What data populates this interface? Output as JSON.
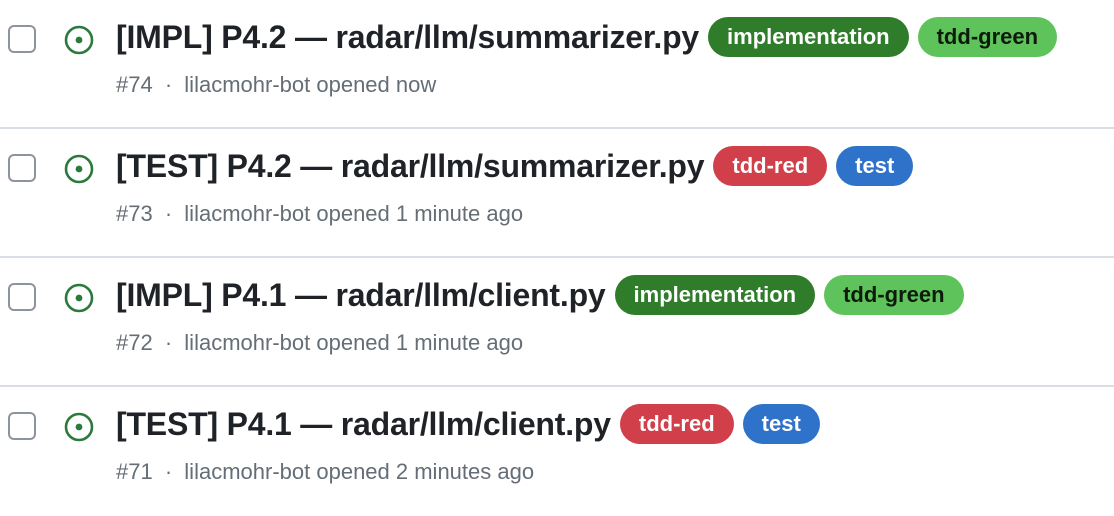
{
  "issues": [
    {
      "title": "[IMPL] P4.2 — radar/llm/summarizer.py",
      "labels": [
        {
          "text": "implementation",
          "bg": "#2f7d2a",
          "fg": "#ffffff"
        },
        {
          "text": "tdd-green",
          "bg": "#5ec35a",
          "fg": "#0d1a0c"
        }
      ],
      "number": "#74",
      "separator": "·",
      "author": "lilacmohr-bot",
      "opened": "opened now"
    },
    {
      "title": "[TEST] P4.2 — radar/llm/summarizer.py",
      "labels": [
        {
          "text": "tdd-red",
          "bg": "#d1404a",
          "fg": "#ffffff"
        },
        {
          "text": "test",
          "bg": "#2f72c9",
          "fg": "#ffffff"
        }
      ],
      "number": "#73",
      "separator": "·",
      "author": "lilacmohr-bot",
      "opened": "opened 1 minute ago"
    },
    {
      "title": "[IMPL] P4.1 — radar/llm/client.py",
      "labels": [
        {
          "text": "implementation",
          "bg": "#2f7d2a",
          "fg": "#ffffff"
        },
        {
          "text": "tdd-green",
          "bg": "#5ec35a",
          "fg": "#0d1a0c"
        }
      ],
      "number": "#72",
      "separator": "·",
      "author": "lilacmohr-bot",
      "opened": "opened 1 minute ago"
    },
    {
      "title": "[TEST] P4.1 — radar/llm/client.py",
      "labels": [
        {
          "text": "tdd-red",
          "bg": "#d1404a",
          "fg": "#ffffff"
        },
        {
          "text": "test",
          "bg": "#2f72c9",
          "fg": "#ffffff"
        }
      ],
      "number": "#71",
      "separator": "·",
      "author": "lilacmohr-bot",
      "opened": "opened 2 minutes ago"
    }
  ],
  "icons": {
    "state": "issue-opened-icon",
    "state_color": "#2b7a3b"
  }
}
